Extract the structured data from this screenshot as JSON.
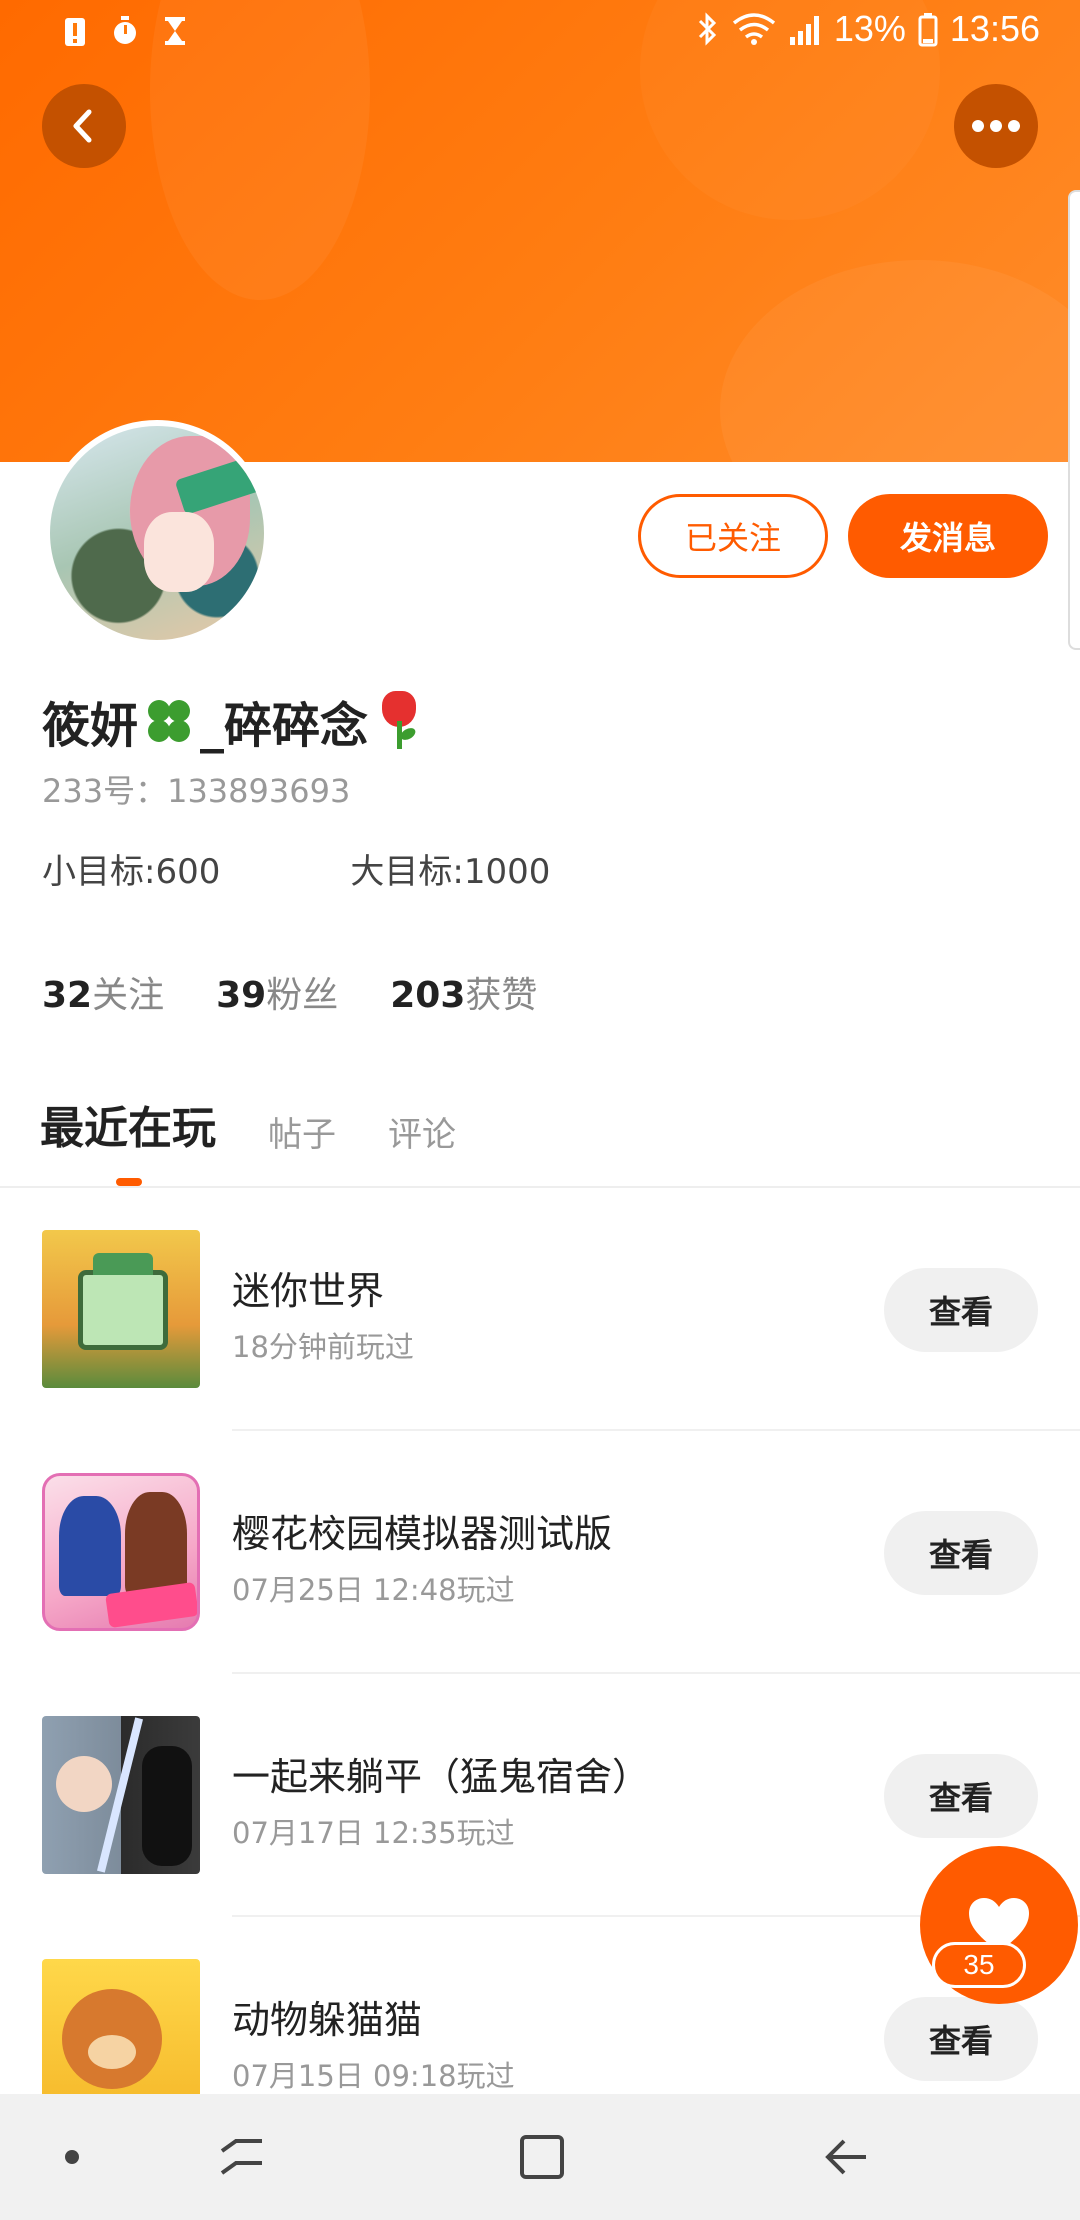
{
  "status_bar": {
    "battery": "13%",
    "time": "13:56",
    "left_icons": [
      "alert-icon",
      "stopwatch-icon",
      "hourglass-icon"
    ],
    "right_icons": [
      "bluetooth-icon",
      "wifi-icon",
      "signal-icon",
      "battery-icon"
    ]
  },
  "header": {
    "back_icon": "chevron-left-icon",
    "more_icon": "more-dots-icon",
    "banner_color": "#ff7a0a"
  },
  "profile": {
    "follow_button": "已关注",
    "message_button": "发消息",
    "name_part1": "筱妍",
    "name_part2": "_碎碎念",
    "name_emoji_1": "clover-icon",
    "name_emoji_2": "tulip-icon",
    "uid": "233号：133893693",
    "goal_small": "小目标:600",
    "goal_big": "大目标:1000",
    "stats": [
      {
        "value": "32",
        "label": "关注"
      },
      {
        "value": "39",
        "label": "粉丝"
      },
      {
        "value": "203",
        "label": "获赞"
      }
    ]
  },
  "tabs": [
    {
      "label": "最近在玩",
      "active": true
    },
    {
      "label": "帖子",
      "active": false
    },
    {
      "label": "评论",
      "active": false
    }
  ],
  "games": [
    {
      "title": "迷你世界",
      "time": "18分钟前玩过",
      "button": "查看",
      "icon": "mini-world-icon"
    },
    {
      "title": "樱花校园模拟器测试版",
      "time": "07月25日 12:48玩过",
      "button": "查看",
      "icon": "sakura-school-icon"
    },
    {
      "title": "一起来躺平（猛鬼宿舍）",
      "time": "07月17日 12:35玩过",
      "button": "查看",
      "icon": "ghost-dorm-icon"
    },
    {
      "title": "动物躲猫猫",
      "time": "07月15日 09:18玩过",
      "button": "查看",
      "icon": "animal-hide-icon"
    }
  ],
  "fab": {
    "icon": "heart-icon",
    "count": "35"
  },
  "colors": {
    "accent": "#ff5b00",
    "muted_text": "#999999",
    "button_gray": "#f0f0f0"
  },
  "nav_bar": {
    "icons": [
      "dot-icon",
      "recents-icon",
      "home-icon",
      "back-icon"
    ]
  }
}
